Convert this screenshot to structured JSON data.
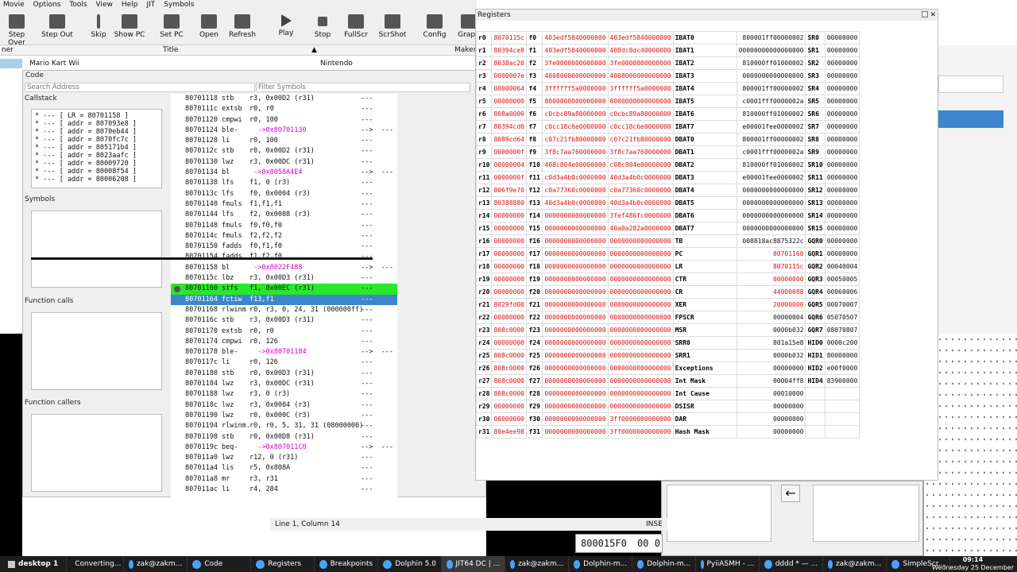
{
  "menu": [
    "Movie",
    "Options",
    "Tools",
    "View",
    "Help",
    "JIT",
    "Symbols"
  ],
  "toolbar": [
    {
      "label": "Step Over",
      "icon": "step-over-icon"
    },
    {
      "label": "Step Out",
      "icon": "step-out-icon"
    },
    {
      "label": "Skip",
      "icon": "skip-icon"
    },
    {
      "label": "Show PC",
      "icon": "show-pc-icon"
    },
    {
      "label": "Set PC",
      "icon": "set-pc-icon"
    },
    {
      "label": "Open",
      "icon": "open-icon"
    },
    {
      "label": "Refresh",
      "icon": "refresh-icon"
    },
    {
      "label": "Play",
      "icon": "play-icon"
    },
    {
      "label": "Stop",
      "icon": "stop-icon"
    },
    {
      "label": "FullScr",
      "icon": "fullscreen-icon"
    },
    {
      "label": "ScrShot",
      "icon": "screenshot-icon"
    },
    {
      "label": "Config",
      "icon": "config-icon"
    },
    {
      "label": "Graph",
      "icon": "graphics-icon"
    }
  ],
  "gamelist": {
    "col_platform": "ner",
    "col_title": "Title",
    "col_maker": "Maker",
    "game_title": "Mario Kart Wii",
    "game_maker": "Nintendo"
  },
  "code": {
    "title": "Code",
    "search_placeholder": "Search Address",
    "filter_placeholder": "Filter Symbols",
    "callstack_label": "Callstack",
    "callstack": [
      "* --- [ LR = 80701158 ]",
      "* --- [ addr = 807093e8 ]",
      "* --- [ addr = 8070eb44 ]",
      "* --- [ addr = 8070fc7c ]",
      "* --- [ addr = 805171b4 ]",
      "* --- [ addr = 8023aafc ]",
      "* --- [ addr = 80009720 ]",
      "* --- [ addr = 80008f54 ]",
      "* --- [ addr = 80006208 ]"
    ],
    "symbols_label": "Symbols",
    "function_calls_label": "Function calls",
    "function_callers_label": "Function callers",
    "disasm": [
      {
        "a": "80701118",
        "m": "stb",
        "o": "r3, 0x00D2 (r31)",
        "f": "---"
      },
      {
        "a": "8070111c",
        "m": "extsb",
        "o": "r0, r0",
        "f": "---"
      },
      {
        "a": "80701120",
        "m": "cmpwi",
        "o": "r0, 100",
        "f": "---"
      },
      {
        "a": "80701124",
        "m": "ble-",
        "o": "  ->0x80701130",
        "f": "-->  ---",
        "br": true
      },
      {
        "a": "80701128",
        "m": "li",
        "o": "r0, 100",
        "f": "---"
      },
      {
        "a": "8070112c",
        "m": "stb",
        "o": "r0, 0x00D2 (r31)",
        "f": "---"
      },
      {
        "a": "80701130",
        "m": "lwz",
        "o": "r3, 0x00DC (r31)",
        "f": "---"
      },
      {
        "a": "80701134",
        "m": "bl",
        "o": " ->0x8058A4E4",
        "f": "-->  ---",
        "br": true
      },
      {
        "a": "80701138",
        "m": "lfs",
        "o": "f1, 0 (r3)",
        "f": "---"
      },
      {
        "a": "8070113c",
        "m": "lfs",
        "o": "f0, 0x0004 (r3)",
        "f": "---"
      },
      {
        "a": "80701140",
        "m": "fmuls",
        "o": "f1,f1,f1",
        "f": "---"
      },
      {
        "a": "80701144",
        "m": "lfs",
        "o": "f2, 0x0008 (r3)",
        "f": "---"
      },
      {
        "a": "80701148",
        "m": "fmuls",
        "o": "f0,f0,f0",
        "f": "---"
      },
      {
        "a": "8070114c",
        "m": "fmuls",
        "o": "f2,f2,f2",
        "f": "---"
      },
      {
        "a": "80701150",
        "m": "fadds",
        "o": "f0,f1,f0",
        "f": "---"
      },
      {
        "a": "80701154",
        "m": "fadds",
        "o": "f1,f2,f0",
        "f": "---"
      },
      {
        "a": "80701158",
        "m": "bl",
        "o": " ->0x8022F488",
        "f": "-->  ---",
        "br": true
      },
      {
        "a": "8070115c",
        "m": "lbz",
        "o": "r3, 0x00D3 (r31)",
        "f": "---"
      },
      {
        "a": "80701160",
        "m": "stfs",
        "o": "f1, 0x00EC (r31)",
        "f": "---",
        "hl": "green",
        "bp": true
      },
      {
        "a": "80701164",
        "m": "fctiw",
        "o": "f13,f1",
        "f": "---",
        "hl": "blue"
      },
      {
        "a": "80701168",
        "m": "rlwinm",
        "o": "r0, r3, 0, 24, 31 (000000ff)",
        "f": "---"
      },
      {
        "a": "8070116c",
        "m": "stb",
        "o": "r3, 0x00D3 (r31)",
        "f": "---"
      },
      {
        "a": "80701170",
        "m": "extsb",
        "o": "r0, r0",
        "f": "---"
      },
      {
        "a": "80701174",
        "m": "cmpwi",
        "o": "r0, 126",
        "f": "---"
      },
      {
        "a": "80701178",
        "m": "ble-",
        "o": "  ->0x80701184",
        "f": "-->  ---",
        "br": true
      },
      {
        "a": "8070117c",
        "m": "li",
        "o": "r0, 126",
        "f": "---"
      },
      {
        "a": "80701180",
        "m": "stb",
        "o": "r0, 0x00D3 (r31)",
        "f": "---"
      },
      {
        "a": "80701184",
        "m": "lwz",
        "o": "r3, 0x00DC (r31)",
        "f": "---"
      },
      {
        "a": "80701188",
        "m": "lwz",
        "o": "r3, 0 (r3)",
        "f": "---"
      },
      {
        "a": "8070118c",
        "m": "lwz",
        "o": "r3, 0x0004 (r3)",
        "f": "---"
      },
      {
        "a": "80701190",
        "m": "lwz",
        "o": "r0, 0x000C (r3)",
        "f": "---"
      },
      {
        "a": "80701194",
        "m": "rlwinm.",
        "o": "r0, r0, 5, 31, 31 (08000000)",
        "f": "---"
      },
      {
        "a": "80701198",
        "m": "stb",
        "o": "r0, 0x00D8 (r31)",
        "f": "---"
      },
      {
        "a": "8070119c",
        "m": "beq-",
        "o": "  ->0x807011C0",
        "f": "-->  ---",
        "br": true
      },
      {
        "a": "807011a0",
        "m": "lwz",
        "o": "r12, 0 (r31)",
        "f": "---"
      },
      {
        "a": "807011a4",
        "m": "lis",
        "o": "r5, 0x808A",
        "f": "---"
      },
      {
        "a": "807011a8",
        "m": "mr",
        "o": "r3, r31",
        "f": "---"
      },
      {
        "a": "807011ac",
        "m": "li",
        "o": "r4, 284",
        "f": "---"
      }
    ]
  },
  "registers": {
    "title": "Registers",
    "rows": [
      [
        "r0",
        "8070115c",
        "f0",
        "403edf5840000000",
        "403edf5840000000",
        "IBAT0",
        "800001ff00000002",
        "SR0",
        "00000000"
      ],
      [
        "r1",
        "80394ce8",
        "f1",
        "403edf5840000000",
        "408dc8dc40000000",
        "IBAT1",
        "00000000000000000",
        "SR1",
        "00000000"
      ],
      [
        "r2",
        "8038ac20",
        "f2",
        "3fe0000000000000",
        "3fe0000000000000",
        "IBAT2",
        "810000ff01000002",
        "SR2",
        "00000000"
      ],
      [
        "r3",
        "0000007e",
        "f3",
        "4008000000000000",
        "4008000000000000",
        "IBAT3",
        "0000000000000000",
        "SR3",
        "00000000"
      ],
      [
        "r4",
        "00000064",
        "f4",
        "3ffffff5a0000000",
        "3ffffff5a0000000",
        "IBAT4",
        "800001ff00000002",
        "SR4",
        "00000000"
      ],
      [
        "r5",
        "00000000",
        "f5",
        "8000000000000000",
        "8000000000000000",
        "IBAT5",
        "c0001fff0000002a",
        "SR5",
        "00000000"
      ],
      [
        "r6",
        "808a0000",
        "f6",
        "c0cbc89a80000000",
        "c0cbc89a80000000",
        "IBAT6",
        "810000ff01000002",
        "SR6",
        "00000000"
      ],
      [
        "r7",
        "80394cd0",
        "f7",
        "c0cc18c6e0000000",
        "c0cc18c6e0000000",
        "IBAT7",
        "e00001fee0000002",
        "SR7",
        "00000000"
      ],
      [
        "r8",
        "8089cd64",
        "f8",
        "c07c21fb80000000",
        "c07c21fb80000000",
        "DBAT0",
        "800001ff00000002",
        "SR8",
        "00000000"
      ],
      [
        "r9",
        "0000000f",
        "f9",
        "3f8c7aa760000000",
        "3f8c7aa760000000",
        "DBAT1",
        "c0001fff0000002a",
        "SR9",
        "00000000"
      ],
      [
        "r10",
        "00000004",
        "f10",
        "408c804e00000000",
        "c08c804e00000000",
        "DBAT2",
        "810000ff01000002",
        "SR10",
        "00000000"
      ],
      [
        "r11",
        "0000000f",
        "f11",
        "c0d3a4b0c0000000",
        "40d3a4b0c0000000",
        "DBAT3",
        "e00001fee0000002",
        "SR11",
        "00000000"
      ],
      [
        "r12",
        "806f9e70",
        "f12",
        "c0a77360c0000000",
        "c0a77360c0000000",
        "DBAT4",
        "0000000000000000",
        "SR12",
        "00000000"
      ],
      [
        "r13",
        "80388880",
        "f13",
        "40d3a4b0c0000000",
        "40d3a4b0c0000000",
        "DBAT5",
        "0000000000000000",
        "SR13",
        "00000000"
      ],
      [
        "r14",
        "00000000",
        "f14",
        "0000000000000000",
        "3fef486fc0000000",
        "DBAT6",
        "0000000000000000",
        "SR14",
        "00000000"
      ],
      [
        "r15",
        "00000000",
        "f15",
        "0000000000000000",
        "40a0a282a0000000",
        "DBAT7",
        "0000000000000000",
        "SR15",
        "00000000"
      ],
      [
        "r16",
        "00000000",
        "f16",
        "0000000000000000",
        "0000000000000000",
        "TB",
        "008818ac8875322c",
        "GQR0",
        "00000000"
      ],
      [
        "r17",
        "00000000",
        "f17",
        "0000000000000000",
        "0000000000000000",
        "PC",
        "80701160",
        "GQR1",
        "00000000"
      ],
      [
        "r18",
        "00000000",
        "f18",
        "0000000000000000",
        "0000000000000000",
        "LR",
        "8070115c",
        "GQR2",
        "00040004"
      ],
      [
        "r19",
        "00000000",
        "f19",
        "0000000000000000",
        "0000000000000000",
        "CTR",
        "00000000",
        "GQR3",
        "00050005"
      ],
      [
        "r20",
        "00000000",
        "f20",
        "0000000000000000",
        "0000000000000000",
        "CR",
        "44000088",
        "GQR4",
        "00060006"
      ],
      [
        "r21",
        "8029fd00",
        "f21",
        "0000000000000000",
        "0000000000000000",
        "XER",
        "20000000",
        "GQR5",
        "00070007"
      ],
      [
        "r22",
        "00000000",
        "f22",
        "0000000000000000",
        "0000000000000000",
        "FPSCR",
        "00000004",
        "GQR6",
        "05070507"
      ],
      [
        "r23",
        "808c0000",
        "f23",
        "0000000000000000",
        "0000000000000000",
        "MSR",
        "0000b032",
        "GQR7",
        "08070807"
      ],
      [
        "r24",
        "00000000",
        "f24",
        "0000000000000000",
        "0000000000000000",
        "SRR0",
        "801a15e8",
        "HID0",
        "0000c200"
      ],
      [
        "r25",
        "808c0000",
        "f25",
        "0000000000000000",
        "0000000000000000",
        "SRR1",
        "0000b032",
        "HID1",
        "80000000"
      ],
      [
        "r26",
        "808c0000",
        "f26",
        "0000000000000000",
        "0000000000000000",
        "Exceptions",
        "00000000",
        "HID2",
        "e00f0000"
      ],
      [
        "r27",
        "808c0000",
        "f27",
        "0000000000000000",
        "0000000000000000",
        "Int Mask",
        "00004ff8",
        "HID4",
        "83900000"
      ],
      [
        "r28",
        "808c0000",
        "f28",
        "0000000000000000",
        "0000000000000000",
        "Int Cause",
        "00010000",
        "",
        ""
      ],
      [
        "r29",
        "00000000",
        "f29",
        "0000000000000000",
        "0000000000000000",
        "DSISR",
        "00000000",
        "",
        ""
      ],
      [
        "r30",
        "00000000",
        "f30",
        "0000000000000000",
        "3ff0000000000000",
        "DAR",
        "00000000",
        "",
        ""
      ],
      [
        "r31",
        "80e4ee98",
        "f31",
        "0000000000000000",
        "3ff0000000000000",
        "Hash Mask",
        "00000000",
        "",
        ""
      ]
    ],
    "red_cols": [
      1,
      3,
      4
    ],
    "red_special": [
      "PC",
      "LR",
      "CTR",
      "CR",
      "XER"
    ]
  },
  "status": {
    "position": "Line 1, Column 14",
    "mode": "INSE"
  },
  "memory_addr": "800015F0",
  "memory_addr2": "00 0",
  "taskbar": {
    "desktop": "desktop 1",
    "tasks": [
      "Converting...",
      "zak@zakm...",
      "Code",
      "Registers",
      "Breakpoints",
      "Dolphin 5.0",
      "JIT64 DC | ...",
      "zak@zakm...",
      "Dolphin-m...",
      "Dolphin-m...",
      "PyiiASMH - ...",
      "dddd * — ...",
      "zak@zakm...",
      "SimpleScr..."
    ],
    "clock_time": "09:14",
    "clock_date": "Wednesday 25 December"
  }
}
